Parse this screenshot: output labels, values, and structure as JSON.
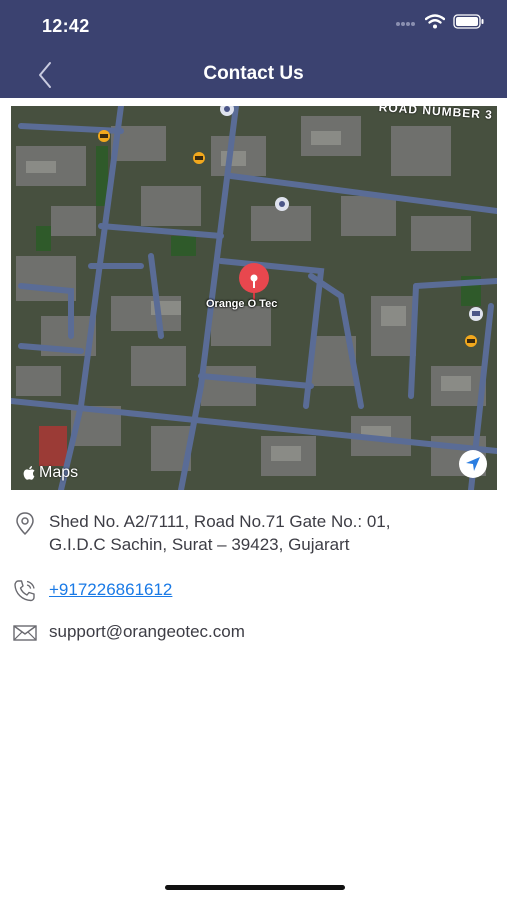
{
  "status_bar": {
    "time": "12:42"
  },
  "header": {
    "title": "Contact Us"
  },
  "map": {
    "pin_label": "Orange O Tec",
    "road_label": "ROAD NUMBER 3",
    "attribution": "Maps"
  },
  "contact": {
    "address_line1": "Shed No. A2/7111, Road No.71 Gate No.: 01,",
    "address_line2": "G.I.D.C Sachin, Surat – 39423, Gujarart",
    "phone": "+917226861612",
    "email": "support@orangeotec.com"
  },
  "colors": {
    "header_bg": "#3b4270",
    "link": "#1a7ae6",
    "pin": "#e8474e"
  }
}
